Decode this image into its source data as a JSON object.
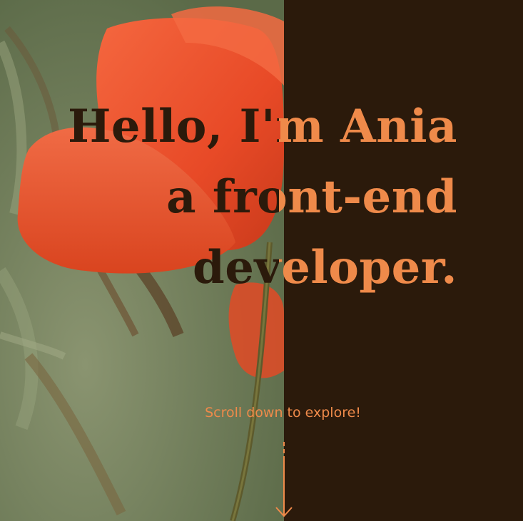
{
  "hero": {
    "headline": {
      "line1": "Hello, I'm Ania",
      "line2": "a front-end",
      "line3": "developer."
    },
    "scroll_hint": "Scroll down to explore!",
    "scroll_icon": "arrow-down-icon",
    "background_image": "poppy-flower-photo"
  },
  "colors": {
    "accent": "#ef8a4a",
    "dark_panel": "#2b1a0b",
    "poppy_red": "#e8492b",
    "foliage_green": "#6f7c5a"
  }
}
